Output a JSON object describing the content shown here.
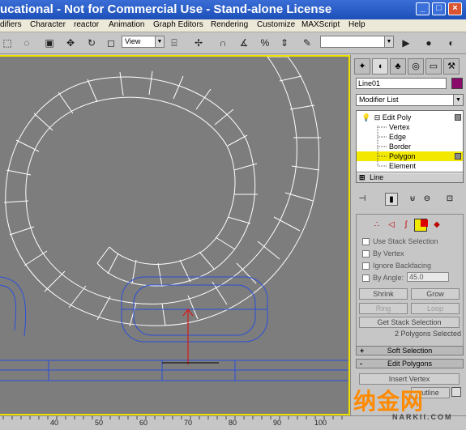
{
  "window": {
    "title": "ucational - Not for Commercial Use - Stand-alone License",
    "buttons": [
      "_",
      "□",
      "×"
    ]
  },
  "menu": [
    "difiers",
    "Character",
    "reactor",
    "Animation",
    "Graph Editors",
    "Rendering",
    "Customize",
    "MAXScript",
    "Help"
  ],
  "toolbar": {
    "view_select": "View",
    "icons": [
      "select-icon",
      "select-region-icon",
      "move-icon",
      "rotate-icon",
      "scale-icon",
      "snap-icon",
      "angle-snap-icon",
      "percent-snap-icon",
      "mirror-icon",
      "align-icon",
      "material-editor-icon",
      "render-icon"
    ],
    "named_selection": ""
  },
  "command_panel": {
    "tabs": [
      "create-tab",
      "modify-tab",
      "hierarchy-tab",
      "motion-tab",
      "display-tab",
      "utilities-tab"
    ],
    "object_name": "Line01",
    "object_color": "#8a0a6a",
    "modifier_list": "Modifier List",
    "stack": [
      {
        "label": "Edit Poly",
        "level": 0
      },
      {
        "label": "Vertex",
        "level": 1
      },
      {
        "label": "Edge",
        "level": 1
      },
      {
        "label": "Border",
        "level": 1
      },
      {
        "label": "Polygon",
        "level": 1,
        "selected": true
      },
      {
        "label": "Element",
        "level": 1
      }
    ],
    "base_object": "Line",
    "selection": {
      "use_stack_selection": "Use Stack Selection",
      "by_vertex": "By Vertex",
      "ignore_backfacing": "Ignore Backfacing",
      "by_angle": "By Angle:",
      "angle_value": "45.0",
      "shrink": "Shrink",
      "grow": "Grow",
      "ring": "Ring",
      "loop": "Loop",
      "get_stack_selection": "Get Stack Selection",
      "status": "2 Polygons Selected"
    },
    "rollouts": {
      "soft_selection": "Soft Selection",
      "soft_sign": "+",
      "edit_polygons": "Edit Polygons",
      "edit_sign": "-",
      "insert_vertex": "Insert Vertex",
      "outline": "utline"
    },
    "selection_color": "#f2e800"
  },
  "timeline": {
    "ticks": [
      "40",
      "50",
      "60",
      "70",
      "80",
      "90",
      "100"
    ]
  },
  "watermark": {
    "chinese": "纳金网",
    "latin": "NARKII.COM"
  },
  "viewport": {
    "border_color": "#f0e000",
    "background": "#7d7d7d"
  }
}
